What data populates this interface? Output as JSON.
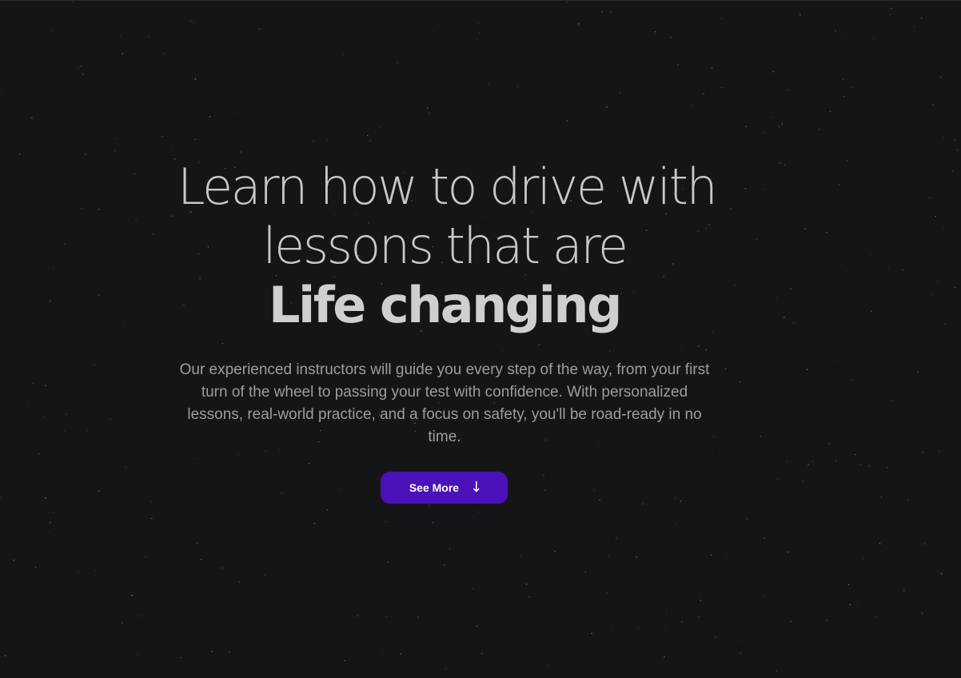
{
  "hero": {
    "headline_line1": "Learn how to drive with",
    "headline_line2": "lessons that are",
    "headline_emphasis": "Life changing",
    "description": "Our experienced instructors will guide you every step of the way, from your first turn of the wheel to passing your test with confidence. With personalized lessons, real-world practice, and a focus on safety, you'll be road-ready in no time."
  },
  "cta": {
    "label": "See More",
    "icon": "arrow-down-icon",
    "arrow_glyph": "↓"
  },
  "colors": {
    "background": "#151518",
    "headline": "#c8c8c8",
    "body_text": "#9d9d9d",
    "button": "#4a12b8",
    "button_text": "#ffffff",
    "star": "#6a6a72"
  }
}
